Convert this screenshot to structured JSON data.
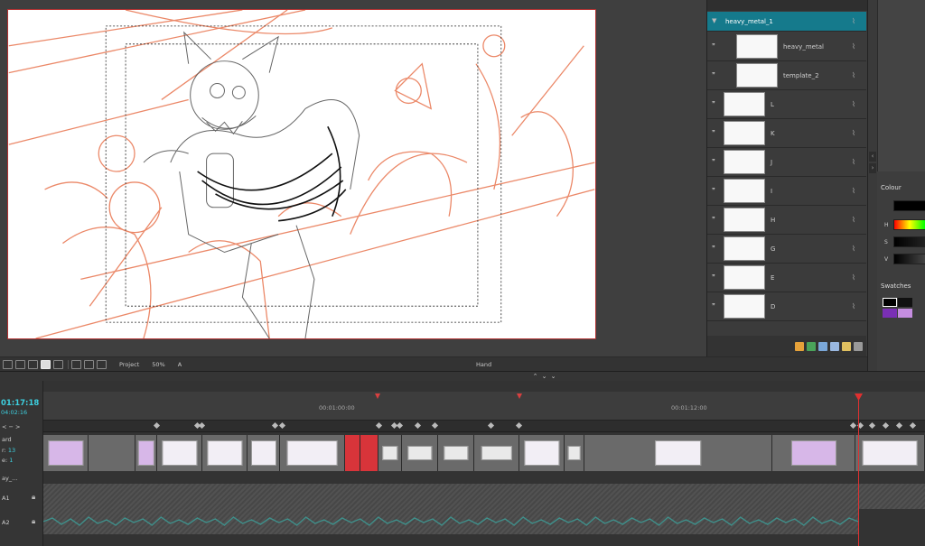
{
  "view_toolbar": {
    "project_label": "Project",
    "zoom_label": "50%",
    "a_label": "A",
    "tool_label": "Hand"
  },
  "layers": [
    {
      "name": "heavy_metal_1",
      "selected": true
    },
    {
      "name": "heavy_metal",
      "selected": false
    },
    {
      "name": "template_2",
      "selected": false
    },
    {
      "name": "L",
      "selected": false
    },
    {
      "name": "K",
      "selected": false
    },
    {
      "name": "J",
      "selected": false
    },
    {
      "name": "I",
      "selected": false
    },
    {
      "name": "H",
      "selected": false
    },
    {
      "name": "G",
      "selected": false
    },
    {
      "name": "E",
      "selected": false
    },
    {
      "name": "D",
      "selected": false
    }
  ],
  "colour_panel": {
    "title": "Colour",
    "h_label": "H",
    "s_label": "S",
    "v_label": "V",
    "swatches_title": "Swatches",
    "colors": {
      "black": "#000000",
      "purple": "#7a2fb5",
      "lilac": "#c58de0"
    }
  },
  "timeline": {
    "timecode": "01:17:18",
    "timecode_sub": "04:02:16",
    "ruler_label_1": "00:01:00:00",
    "ruler_label_2": "00:01:12:00",
    "left_labels": {
      "board": "ard",
      "scene_prefix": "r:",
      "scene_value": "13",
      "panel_prefix": "e:",
      "panel_value": "1",
      "track_dd": "ay_...",
      "a1": "A1",
      "a2": "A2"
    }
  },
  "accent": "#157a8c",
  "playhead_color": "#e03030"
}
